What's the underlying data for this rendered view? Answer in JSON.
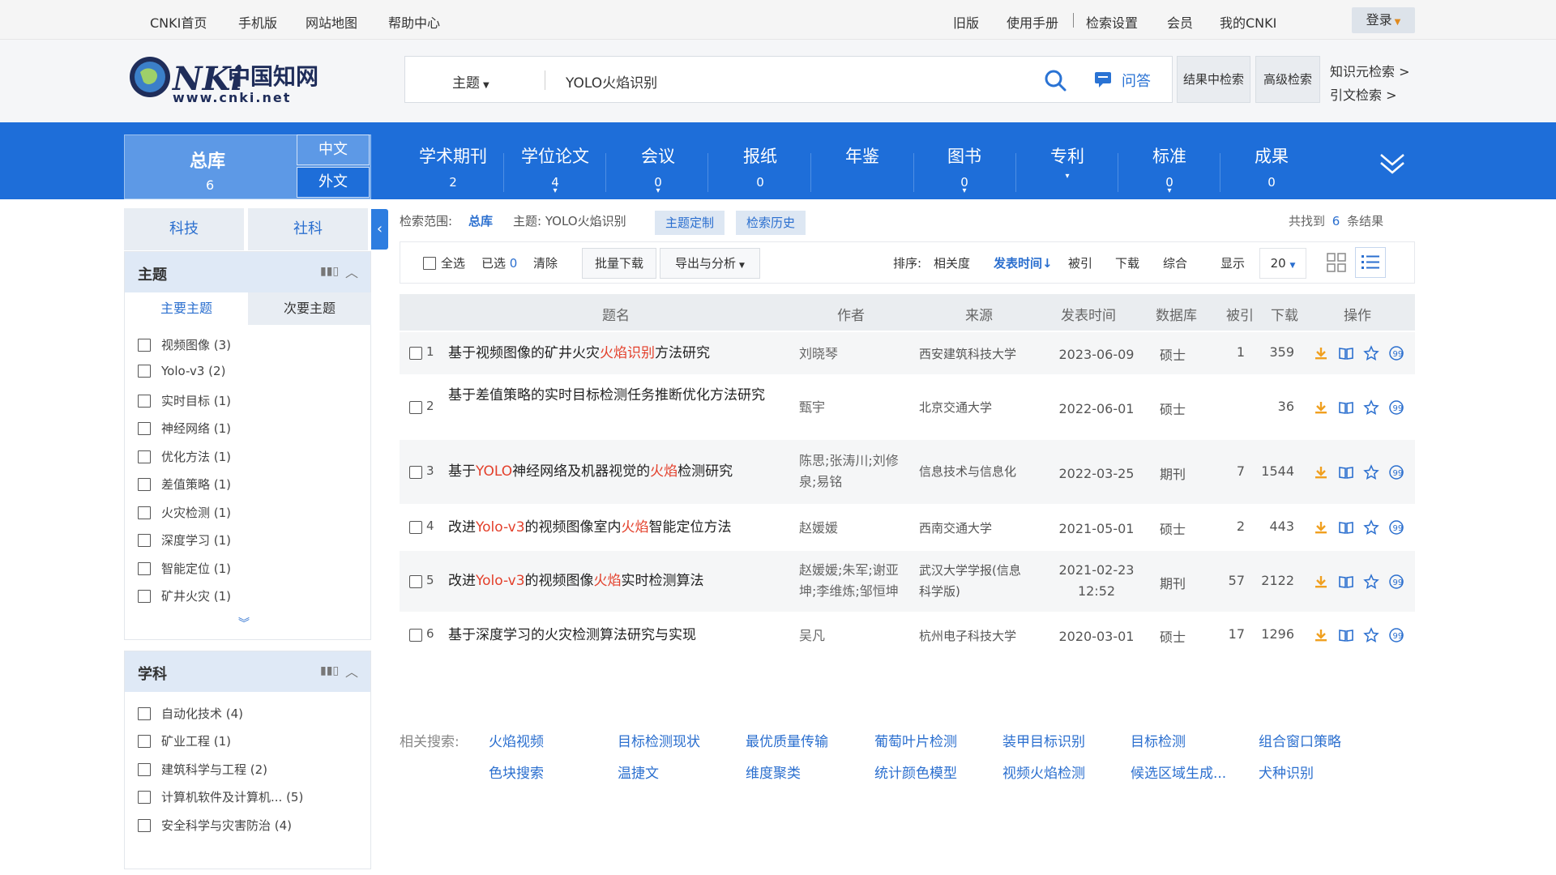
{
  "topbar": {
    "left_links": [
      "CNKI首页",
      "手机版",
      "网站地图",
      "帮助中心"
    ],
    "right_links": [
      "旧版",
      "使用手册",
      "检索设置",
      "会员",
      "我的CNKI"
    ],
    "login": "登录"
  },
  "header": {
    "logo_text": "中国知网",
    "logo_url": "www.cnki.net",
    "search_type": "主题",
    "search_query": "YOLO火焰识别",
    "qa_label": "问答",
    "result_search": "结果中检索",
    "advanced_search": "高级检索",
    "knowledge_search": "知识元检索 >",
    "citation_search": "引文检索 >"
  },
  "nav": {
    "all": {
      "label": "总库",
      "count": "6"
    },
    "lang": [
      "中文",
      "外文"
    ],
    "items": [
      {
        "label": "学术期刊",
        "count": "2"
      },
      {
        "label": "学位论文",
        "count": "4"
      },
      {
        "label": "会议",
        "count": "0"
      },
      {
        "label": "报纸",
        "count": "0"
      },
      {
        "label": "年鉴",
        "count": ""
      },
      {
        "label": "图书",
        "count": "0"
      },
      {
        "label": "专利",
        "count": ""
      },
      {
        "label": "标准",
        "count": "0"
      },
      {
        "label": "成果",
        "count": "0"
      }
    ]
  },
  "sidebar": {
    "tabs": [
      "科技",
      "社科"
    ],
    "topic_panel": {
      "title": "主题",
      "tabs": [
        "主要主题",
        "次要主题"
      ],
      "items": [
        "视频图像 (3)",
        "Yolo-v3 (2)",
        "实时目标 (1)",
        "神经网络 (1)",
        "优化方法 (1)",
        "差值策略 (1)",
        "火灾检测 (1)",
        "深度学习 (1)",
        "智能定位 (1)",
        "矿井火灾 (1)"
      ]
    },
    "subject_panel": {
      "title": "学科",
      "items": [
        "自动化技术 (4)",
        "矿业工程 (1)",
        "建筑科学与工程 (2)",
        "计算机软件及计算机... (5)",
        "安全科学与灾害防治 (4)"
      ]
    }
  },
  "results": {
    "scope_label": "检索范围:",
    "scope_value": "总库",
    "topic_label": "主题: YOLO火焰识别",
    "topic_custom": "主题定制",
    "search_history": "检索历史",
    "found_prefix": "共找到",
    "found_count": "6",
    "found_suffix": "条结果",
    "toolbar": {
      "select_all": "全选",
      "selected": "已选",
      "selected_count": "0",
      "clear": "清除",
      "batch_download": "批量下载",
      "export": "导出与分析",
      "sort_label": "排序:",
      "sort_options": [
        "相关度",
        "发表时间",
        "被引",
        "下载",
        "综合"
      ],
      "display_label": "显示",
      "display_value": "20"
    },
    "columns": [
      "题名",
      "作者",
      "来源",
      "发表时间",
      "数据库",
      "被引",
      "下载",
      "操作"
    ],
    "rows": [
      {
        "idx": "1",
        "title": [
          {
            "t": "基于视频图像的矿井火灾"
          },
          {
            "t": "火焰识别",
            "hl": true
          },
          {
            "t": "方法研究"
          }
        ],
        "author": "刘晓琴",
        "source": "西安建筑科技大学",
        "date": "2023-06-09",
        "db": "硕士",
        "cited": "1",
        "downloads": "359"
      },
      {
        "idx": "2",
        "title": [
          {
            "t": "基于差值策略的实时目标检测任务推断优化方法研究"
          }
        ],
        "author": "甄宇",
        "source": "北京交通大学",
        "date": "2022-06-01",
        "db": "硕士",
        "cited": "",
        "downloads": "36"
      },
      {
        "idx": "3",
        "title": [
          {
            "t": "基于"
          },
          {
            "t": "YOLO",
            "hl": true
          },
          {
            "t": "神经网络及机器视觉的"
          },
          {
            "t": "火焰",
            "hl": true
          },
          {
            "t": "检测研究"
          }
        ],
        "author": "陈思;张涛川;刘修泉;易铭",
        "source": "信息技术与信息化",
        "date": "2022-03-25",
        "db": "期刊",
        "cited": "7",
        "downloads": "1544"
      },
      {
        "idx": "4",
        "title": [
          {
            "t": "改进"
          },
          {
            "t": "Yolo-v3",
            "hl": true
          },
          {
            "t": "的视频图像室内"
          },
          {
            "t": "火焰",
            "hl": true
          },
          {
            "t": "智能定位方法"
          }
        ],
        "author": "赵媛媛",
        "source": "西南交通大学",
        "date": "2021-05-01",
        "db": "硕士",
        "cited": "2",
        "downloads": "443"
      },
      {
        "idx": "5",
        "title": [
          {
            "t": "改进"
          },
          {
            "t": "Yolo-v3",
            "hl": true
          },
          {
            "t": "的视频图像"
          },
          {
            "t": "火焰",
            "hl": true
          },
          {
            "t": "实时检测算法"
          }
        ],
        "author": "赵媛媛;朱军;谢亚坤;李维炼;邹恒坤",
        "source": "武汉大学学报(信息科学版)",
        "date": "2021-02-23 12:52",
        "db": "期刊",
        "cited": "57",
        "downloads": "2122"
      },
      {
        "idx": "6",
        "title": [
          {
            "t": "基于深度学习的火灾检测算法研究与实现"
          }
        ],
        "author": "吴凡",
        "source": "杭州电子科技大学",
        "date": "2020-03-01",
        "db": "硕士",
        "cited": "17",
        "downloads": "1296"
      }
    ]
  },
  "related": {
    "label": "相关搜索:",
    "links": [
      "火焰视频",
      "目标检测现状",
      "最优质量传输",
      "葡萄叶片检测",
      "装甲目标识别",
      "目标检测",
      "组合窗口策略",
      "色块搜索",
      "温捷文",
      "维度聚类",
      "统计颜色模型",
      "视频火焰检测",
      "候选区域生成...",
      "犬种识别"
    ]
  },
  "colors": {
    "nav_blue": "#1e6ed9",
    "highlight_red": "#e33f2a",
    "link_blue": "#2b6fcf",
    "download_orange": "#f0a020"
  }
}
